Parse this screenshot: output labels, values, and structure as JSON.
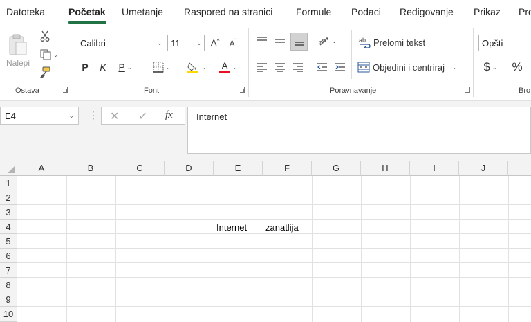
{
  "tabs": [
    "Datoteka",
    "Početak",
    "Umetanje",
    "Raspored na stranici",
    "Formule",
    "Podaci",
    "Redigovanje",
    "Prikaz",
    "Pro"
  ],
  "active_tab": "Početak",
  "accent_color": "#217346",
  "clipboard": {
    "paste_label": "Nalepi",
    "group_label": "Ostava"
  },
  "font": {
    "name": "Calibri",
    "size": "11",
    "group_label": "Font",
    "bold": "P",
    "italic": "K",
    "underline": "P",
    "font_color": "#e81123",
    "highlight_color": "#ffd800"
  },
  "alignment": {
    "wrap_text": "Prelomi tekst",
    "merge_center": "Objedini i centriraj",
    "group_label": "Poravnavanje"
  },
  "number": {
    "format": "Opšti",
    "group_label": "Bro",
    "currency": "$",
    "percent": "%"
  },
  "formula_bar": {
    "name_box": "E4",
    "content": "Internet",
    "fx": "fx",
    "cancel": "✕",
    "enter": "✓"
  },
  "grid": {
    "columns": [
      "A",
      "B",
      "C",
      "D",
      "E",
      "F",
      "G",
      "H",
      "I",
      "J"
    ],
    "rows": [
      "1",
      "2",
      "3",
      "4",
      "5",
      "6",
      "7",
      "8",
      "9",
      "10"
    ],
    "cells": {
      "E4": "Internet",
      "F4": "zanatlija"
    }
  }
}
